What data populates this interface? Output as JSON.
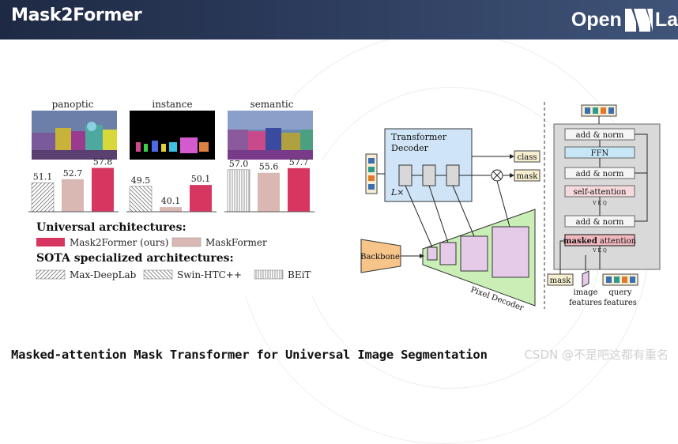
{
  "header": {
    "title": "Mask2Former",
    "logo_text_left": "Open",
    "logo_text_right": "La"
  },
  "caption": "Masked-attention Mask Transformer for Universal Image Segmentation",
  "watermark": "CSDN @不是吧这都有重名",
  "chart_data": {
    "type": "bar",
    "panels": [
      "panoptic",
      "instance",
      "semantic"
    ],
    "series": [
      {
        "name": "SOTA specialized",
        "values": [
          51.1,
          49.5,
          57.0
        ],
        "labels": [
          "51.1",
          "49.5",
          "57.0"
        ]
      },
      {
        "name": "MaskFormer",
        "values": [
          52.7,
          40.1,
          55.6
        ],
        "labels": [
          "52.7",
          "40.1",
          "55.6"
        ]
      },
      {
        "name": "Mask2Former (ours)",
        "values": [
          57.8,
          50.1,
          57.7
        ],
        "labels": [
          "57.8",
          "50.1",
          "57.7"
        ]
      }
    ],
    "colors": {
      "mask2former": "#d6365f",
      "maskformer": "#d9b8b4",
      "hatch": "#888888"
    }
  },
  "legend": {
    "universal_title": "Universal architectures:",
    "mask2former": "Mask2Former (ours)",
    "maskformer": "MaskFormer",
    "sota_title": "SOTA specialized architectures:",
    "maxdeeplab": "Max-DeepLab",
    "swinhtc": "Swin-HTC++",
    "beit": "BEiT"
  },
  "diagram": {
    "transformer_decoder": "Transformer Decoder",
    "lx": "L×",
    "class": "class",
    "mask": "mask",
    "backbone": "Backbone",
    "pixel_decoder": "Pixel Decoder",
    "add_norm": "add & norm",
    "ffn": "FFN",
    "self_attention": "self-attention",
    "masked_attention_bold": "masked",
    "masked_attention_rest": " attention",
    "vkq": [
      "V",
      "K",
      "Q"
    ],
    "mask_input": "mask",
    "image_features": [
      "image",
      "features"
    ],
    "query_features": [
      "query",
      "features"
    ]
  }
}
